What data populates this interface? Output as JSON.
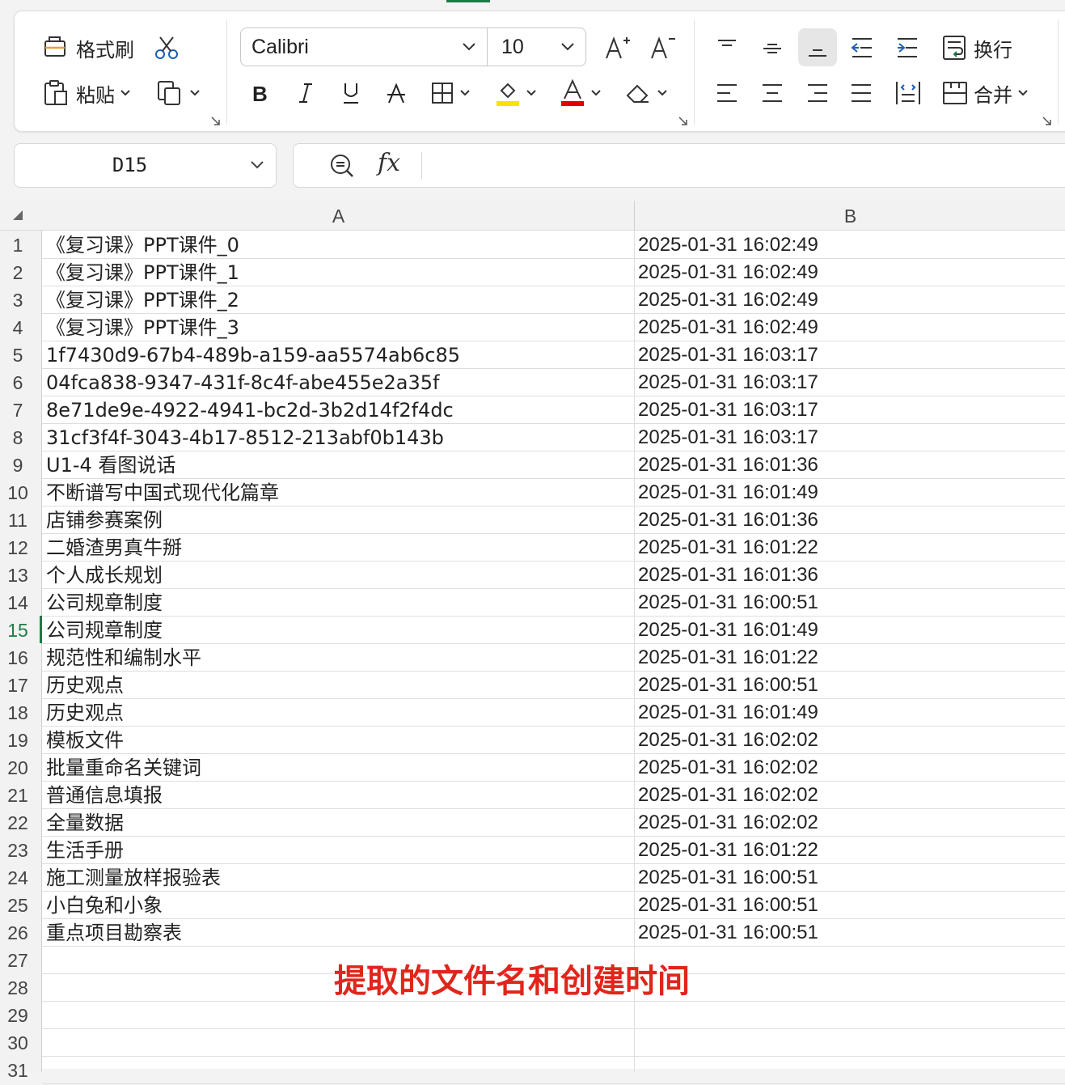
{
  "ribbon": {
    "format_painter_label": "格式刷",
    "paste_label": "粘贴",
    "font_name": "Calibri",
    "font_size": "10",
    "wrap_label": "换行",
    "merge_label": "合并"
  },
  "name_box": "D15",
  "formula_label": "fx",
  "columns": [
    "A",
    "B"
  ],
  "active_row": 15,
  "rows": [
    {
      "num": "1",
      "a": "《复习课》PPT课件_0",
      "b": "2025-01-31 16:02:49"
    },
    {
      "num": "2",
      "a": "《复习课》PPT课件_1",
      "b": "2025-01-31 16:02:49"
    },
    {
      "num": "3",
      "a": "《复习课》PPT课件_2",
      "b": "2025-01-31 16:02:49"
    },
    {
      "num": "4",
      "a": "《复习课》PPT课件_3",
      "b": "2025-01-31 16:02:49"
    },
    {
      "num": "5",
      "a": "1f7430d9-67b4-489b-a159-aa5574ab6c85",
      "b": "2025-01-31 16:03:17"
    },
    {
      "num": "6",
      "a": "04fca838-9347-431f-8c4f-abe455e2a35f",
      "b": "2025-01-31 16:03:17"
    },
    {
      "num": "7",
      "a": "8e71de9e-4922-4941-bc2d-3b2d14f2f4dc",
      "b": "2025-01-31 16:03:17"
    },
    {
      "num": "8",
      "a": "31cf3f4f-3043-4b17-8512-213abf0b143b",
      "b": "2025-01-31 16:03:17"
    },
    {
      "num": "9",
      "a": "U1-4 看图说话",
      "b": "2025-01-31 16:01:36"
    },
    {
      "num": "10",
      "a": "不断谱写中国式现代化篇章",
      "b": "2025-01-31 16:01:49"
    },
    {
      "num": "11",
      "a": "店铺参赛案例",
      "b": "2025-01-31 16:01:36"
    },
    {
      "num": "12",
      "a": "二婚渣男真牛掰",
      "b": "2025-01-31 16:01:22"
    },
    {
      "num": "13",
      "a": "个人成长规划",
      "b": "2025-01-31 16:01:36"
    },
    {
      "num": "14",
      "a": "公司规章制度",
      "b": "2025-01-31 16:00:51"
    },
    {
      "num": "15",
      "a": "公司规章制度",
      "b": "2025-01-31 16:01:49"
    },
    {
      "num": "16",
      "a": "规范性和编制水平",
      "b": "2025-01-31 16:01:22"
    },
    {
      "num": "17",
      "a": "历史观点",
      "b": "2025-01-31 16:00:51"
    },
    {
      "num": "18",
      "a": "历史观点",
      "b": "2025-01-31 16:01:49"
    },
    {
      "num": "19",
      "a": "模板文件",
      "b": "2025-01-31 16:02:02"
    },
    {
      "num": "20",
      "a": "批量重命名关键词",
      "b": "2025-01-31 16:02:02"
    },
    {
      "num": "21",
      "a": "普通信息填报",
      "b": "2025-01-31 16:02:02"
    },
    {
      "num": "22",
      "a": "全量数据",
      "b": "2025-01-31 16:02:02"
    },
    {
      "num": "23",
      "a": "生活手册",
      "b": "2025-01-31 16:01:22"
    },
    {
      "num": "24",
      "a": "施工测量放样报验表",
      "b": "2025-01-31 16:00:51"
    },
    {
      "num": "25",
      "a": "小白兔和小象",
      "b": "2025-01-31 16:00:51"
    },
    {
      "num": "26",
      "a": "重点项目勘察表",
      "b": "2025-01-31 16:00:51"
    },
    {
      "num": "27",
      "a": "",
      "b": ""
    },
    {
      "num": "28",
      "a": "",
      "b": ""
    },
    {
      "num": "29",
      "a": "",
      "b": ""
    },
    {
      "num": "30",
      "a": "",
      "b": ""
    },
    {
      "num": "31",
      "a": "",
      "b": ""
    }
  ],
  "annotation": "提取的文件名和创建时间",
  "colors": {
    "accent_green": "#1e7b46",
    "annotation_red": "#e0261c",
    "highlight_yellow": "#f5e400",
    "font_color_red": "#e00000"
  },
  "icons": [
    "format-painter-icon",
    "scissors-icon",
    "paste-icon",
    "copy-icon",
    "bold-icon",
    "italic-icon",
    "underline-icon",
    "strikethrough-icon",
    "borders-icon",
    "fill-color-icon",
    "font-color-icon",
    "eraser-icon",
    "increase-font-icon",
    "decrease-font-icon",
    "align-top-icon",
    "align-middle-icon",
    "align-bottom-icon",
    "decrease-indent-icon",
    "increase-indent-icon",
    "wrap-text-icon",
    "align-left-icon",
    "align-center-icon",
    "align-right-icon",
    "justify-icon",
    "distributed-icon",
    "merge-icon",
    "zoom-formula-icon",
    "fx-icon"
  ]
}
